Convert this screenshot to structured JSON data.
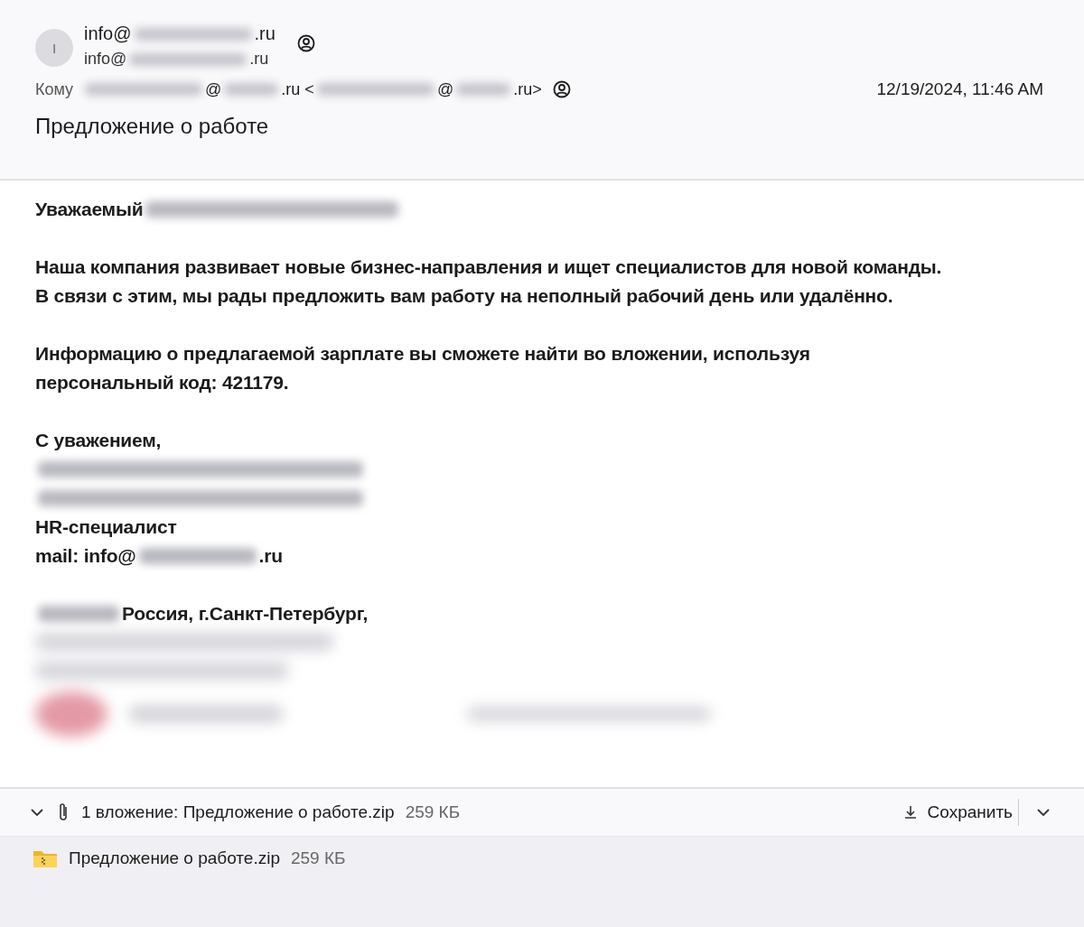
{
  "header": {
    "avatar_initial": "I",
    "from": [
      {
        "kind": "text",
        "text": "info@"
      },
      {
        "kind": "redacted"
      },
      {
        "kind": "text",
        "text": ".ru"
      }
    ],
    "from_address": [
      {
        "kind": "text",
        "text": "info@"
      },
      {
        "kind": "redacted"
      },
      {
        "kind": "text",
        "text": ".ru"
      }
    ],
    "to_label": "Кому",
    "to": [
      {
        "kind": "redacted"
      },
      {
        "kind": "text",
        "text": "@"
      },
      {
        "kind": "redacted"
      },
      {
        "kind": "text",
        "text": ".ru <"
      },
      {
        "kind": "redacted"
      },
      {
        "kind": "text",
        "text": "@"
      },
      {
        "kind": "redacted"
      },
      {
        "kind": "text",
        "text": ".ru>"
      }
    ],
    "date": "12/19/2024, 11:46 AM",
    "subject": "Предложение о работе"
  },
  "body": [
    {
      "kind": "line",
      "parts": [
        {
          "kind": "text",
          "text": "Уважаемый"
        },
        {
          "kind": "redacted"
        }
      ]
    },
    {
      "kind": "gap"
    },
    {
      "kind": "line",
      "parts": [
        {
          "kind": "text",
          "text": "Наша компания развивает новые бизнес-направления и ищет специалистов для новой команды."
        }
      ]
    },
    {
      "kind": "line",
      "parts": [
        {
          "kind": "text",
          "text": "В связи с этим, мы рады предложить вам работу на неполный рабочий день или удалённо."
        }
      ]
    },
    {
      "kind": "gap"
    },
    {
      "kind": "line",
      "parts": [
        {
          "kind": "text",
          "text": "Информацию о предлагаемой зарплате вы сможете найти во вложении, используя"
        }
      ]
    },
    {
      "kind": "line",
      "parts": [
        {
          "kind": "text",
          "text": "персональный код: 421179."
        }
      ]
    },
    {
      "kind": "gap"
    },
    {
      "kind": "line",
      "parts": [
        {
          "kind": "text",
          "text": "С уважением,"
        }
      ]
    },
    {
      "kind": "line",
      "parts": [
        {
          "kind": "redacted"
        }
      ]
    },
    {
      "kind": "line",
      "parts": [
        {
          "kind": "redacted"
        }
      ]
    },
    {
      "kind": "line",
      "parts": [
        {
          "kind": "text",
          "text": "HR-специалист"
        }
      ]
    },
    {
      "kind": "line",
      "parts": [
        {
          "kind": "text",
          "text": "mail: info@"
        },
        {
          "kind": "redacted"
        },
        {
          "kind": "text",
          "text": ".ru"
        }
      ]
    },
    {
      "kind": "gap"
    },
    {
      "kind": "line",
      "parts": [
        {
          "kind": "redacted"
        },
        {
          "kind": "text",
          "text": "Россия, г.Санкт-Петербург,"
        }
      ]
    }
  ],
  "attachments": {
    "summary": "1 вложение: Предложение о работе.zip",
    "summary_size": "259 КБ",
    "save_label": "Сохранить",
    "files": [
      {
        "name": "Предложение о работе.zip",
        "size": "259 КБ"
      }
    ]
  }
}
